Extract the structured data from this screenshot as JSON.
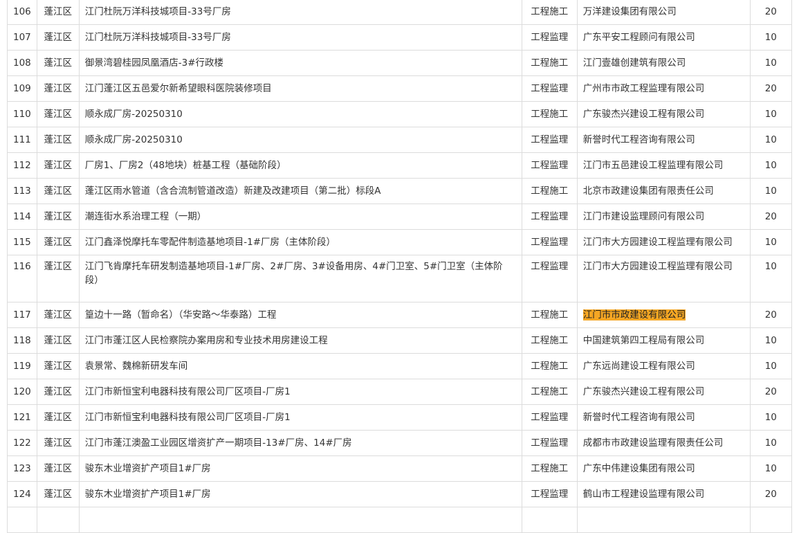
{
  "rows": [
    {
      "no": "106",
      "district": "蓬江区",
      "project": "江门杜阮万洋科技城项目-33号厂房",
      "type": "工程施工",
      "company": "万洋建设集团有限公司",
      "score": "20"
    },
    {
      "no": "107",
      "district": "蓬江区",
      "project": "江门杜阮万洋科技城项目-33号厂房",
      "type": "工程监理",
      "company": "广东平安工程顾问有限公司",
      "score": "10"
    },
    {
      "no": "108",
      "district": "蓬江区",
      "project": "御景湾碧桂园凤凰酒店-3#行政楼",
      "type": "工程施工",
      "company": "江门壹雄创建筑有限公司",
      "score": "10"
    },
    {
      "no": "109",
      "district": "蓬江区",
      "project": "江门蓬江区五邑爱尔新希望眼科医院装修项目",
      "type": "工程监理",
      "company": "广州市市政工程监理有限公司",
      "score": "20"
    },
    {
      "no": "110",
      "district": "蓬江区",
      "project": "顺永成厂房-20250310",
      "type": "工程施工",
      "company": "广东骏杰兴建设工程有限公司",
      "score": "10"
    },
    {
      "no": "111",
      "district": "蓬江区",
      "project": "顺永成厂房-20250310",
      "type": "工程监理",
      "company": "新誉时代工程咨询有限公司",
      "score": "10"
    },
    {
      "no": "112",
      "district": "蓬江区",
      "project": "厂房1、厂房2（48地块）桩基工程（基础阶段）",
      "type": "工程监理",
      "company": "江门市五邑建设工程监理有限公司",
      "score": "10"
    },
    {
      "no": "113",
      "district": "蓬江区",
      "project": "蓬江区雨水管道（含合流制管道改造）新建及改建项目（第二批）标段A",
      "type": "工程施工",
      "company": "北京市政建设集团有限责任公司",
      "score": "10"
    },
    {
      "no": "114",
      "district": "蓬江区",
      "project": "潮连街水系治理工程（一期）",
      "type": "工程监理",
      "company": "江门市建设监理顾问有限公司",
      "score": "20"
    },
    {
      "no": "115",
      "district": "蓬江区",
      "project": "江门鑫泽悦摩托车零配件制造基地项目-1#厂房（主体阶段）",
      "type": "工程监理",
      "company": "江门市大方园建设工程监理有限公司",
      "score": "10"
    },
    {
      "no": "116",
      "district": "蓬江区",
      "project": "江门飞肯摩托车研发制造基地项目-1#厂房、2#厂房、3#设备用房、4#门卫室、5#门卫室（主体阶段）",
      "type": "工程监理",
      "company": "江门市大方园建设工程监理有限公司",
      "score": "10",
      "tall": true
    },
    {
      "no": "117",
      "district": "蓬江区",
      "project": "篁边十一路（暂命名）（华安路～华泰路）工程",
      "type": "工程施工",
      "company": "江门市市政建设有限公司",
      "score": "20",
      "highlight": true
    },
    {
      "no": "118",
      "district": "蓬江区",
      "project": "江门市蓬江区人民检察院办案用房和专业技术用房建设工程",
      "type": "工程施工",
      "company": "中国建筑第四工程局有限公司",
      "score": "10"
    },
    {
      "no": "119",
      "district": "蓬江区",
      "project": "袁景常、魏棉新研发车间",
      "type": "工程施工",
      "company": "广东远尚建设工程有限公司",
      "score": "10"
    },
    {
      "no": "120",
      "district": "蓬江区",
      "project": "江门市新恒宝利电器科技有限公司厂区项目-厂房1",
      "type": "工程施工",
      "company": "广东骏杰兴建设工程有限公司",
      "score": "20"
    },
    {
      "no": "121",
      "district": "蓬江区",
      "project": "江门市新恒宝利电器科技有限公司厂区项目-厂房1",
      "type": "工程监理",
      "company": "新誉时代工程咨询有限公司",
      "score": "10"
    },
    {
      "no": "122",
      "district": "蓬江区",
      "project": "江门市蓬江澳盈工业园区增资扩产一期项目-13#厂房、14#厂房",
      "type": "工程监理",
      "company": "成都市市政建设监理有限责任公司",
      "score": "10"
    },
    {
      "no": "123",
      "district": "蓬江区",
      "project": "骏东木业增资扩产项目1#厂房",
      "type": "工程施工",
      "company": "广东中伟建设集团有限公司",
      "score": "10"
    },
    {
      "no": "124",
      "district": "蓬江区",
      "project": "骏东木业增资扩产项目1#厂房",
      "type": "工程监理",
      "company": "鹤山市工程建设监理有限公司",
      "score": "20"
    },
    {
      "no": "",
      "district": "",
      "project": "",
      "type": "",
      "company": "",
      "score": ""
    }
  ],
  "highlight_color": "#f5a623"
}
